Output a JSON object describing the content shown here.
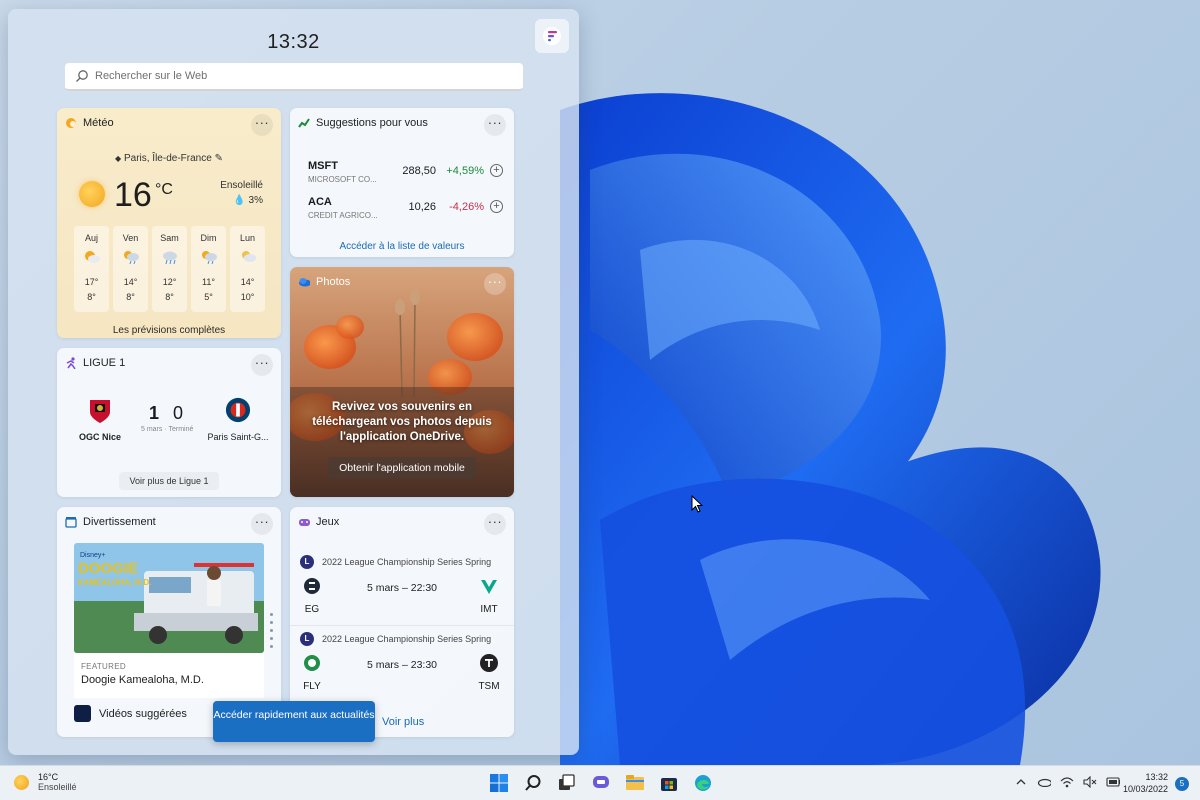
{
  "panel": {
    "clock": "13:32",
    "search_placeholder": "Rechercher sur le Web"
  },
  "weather": {
    "title": "Météo",
    "location": "Paris, Île-de-France",
    "temp": "16",
    "unit": "°C",
    "condition": "Ensoleillé",
    "precip": "3%",
    "days": [
      {
        "day": "Auj",
        "icon": "partly-sunny-icon",
        "high": "17°",
        "low": "8°"
      },
      {
        "day": "Ven",
        "icon": "sun-rain-icon",
        "high": "14°",
        "low": "8°"
      },
      {
        "day": "Sam",
        "icon": "rain-cloud-icon",
        "high": "12°",
        "low": "8°"
      },
      {
        "day": "Dim",
        "icon": "sun-rain-icon",
        "high": "11°",
        "low": "5°"
      },
      {
        "day": "Lun",
        "icon": "partly-cloudy-icon",
        "high": "14°",
        "low": "10°"
      }
    ],
    "link": "Les prévisions complètes"
  },
  "stocks": {
    "title": "Suggestions pour vous",
    "rows": [
      {
        "symbol": "MSFT",
        "name": "MICROSOFT CO...",
        "price": "288,50",
        "change": "+4,59%",
        "direction": "up"
      },
      {
        "symbol": "ACA",
        "name": "CREDIT AGRICO...",
        "price": "10,26",
        "change": "-4,26%",
        "direction": "down"
      }
    ],
    "link": "Accéder à la liste de valeurs",
    "colors": {
      "up": "#1d8a3c",
      "down": "#c4314b"
    }
  },
  "photos": {
    "title": "Photos",
    "message": "Revivez vos souvenirs en téléchargeant vos photos depuis l'application OneDrive.",
    "button": "Obtenir l'application mobile"
  },
  "ligue": {
    "title": "LIGUE 1",
    "home": "OGC Nice",
    "away": "Paris Saint-G...",
    "home_score": "1",
    "away_score": "0",
    "meta": "5 mars · Terminé",
    "link": "Voir plus de Ligue 1"
  },
  "divert": {
    "title": "Divertissement",
    "featured": "FEATURED",
    "item": "Doogie Kamealoha, M.D.",
    "poster_text": [
      "DOOGIE",
      "KAMEALOHA, M.D."
    ],
    "poster_brand": "Disney+",
    "footer": "Vidéos suggérées"
  },
  "jeux": {
    "title": "Jeux",
    "matches": [
      {
        "league": "2022 League Championship Series Spring",
        "team1": "EG",
        "team2": "IMT",
        "time": "5 mars – 22:30"
      },
      {
        "league": "2022 League Championship Series Spring",
        "team1": "FLY",
        "team2": "TSM",
        "time": "5 mars – 23:30"
      }
    ],
    "more": "Voir plus"
  },
  "toast": "Accéder rapidement aux actualités",
  "taskbar": {
    "weather_temp": "16°C",
    "weather_cond": "Ensoleillé",
    "time": "13:32",
    "date": "10/03/2022",
    "notifications": "5",
    "apps": [
      "start-icon",
      "search-icon",
      "task-view-icon",
      "chat-icon",
      "file-explorer-icon",
      "store-icon",
      "edge-icon"
    ]
  }
}
